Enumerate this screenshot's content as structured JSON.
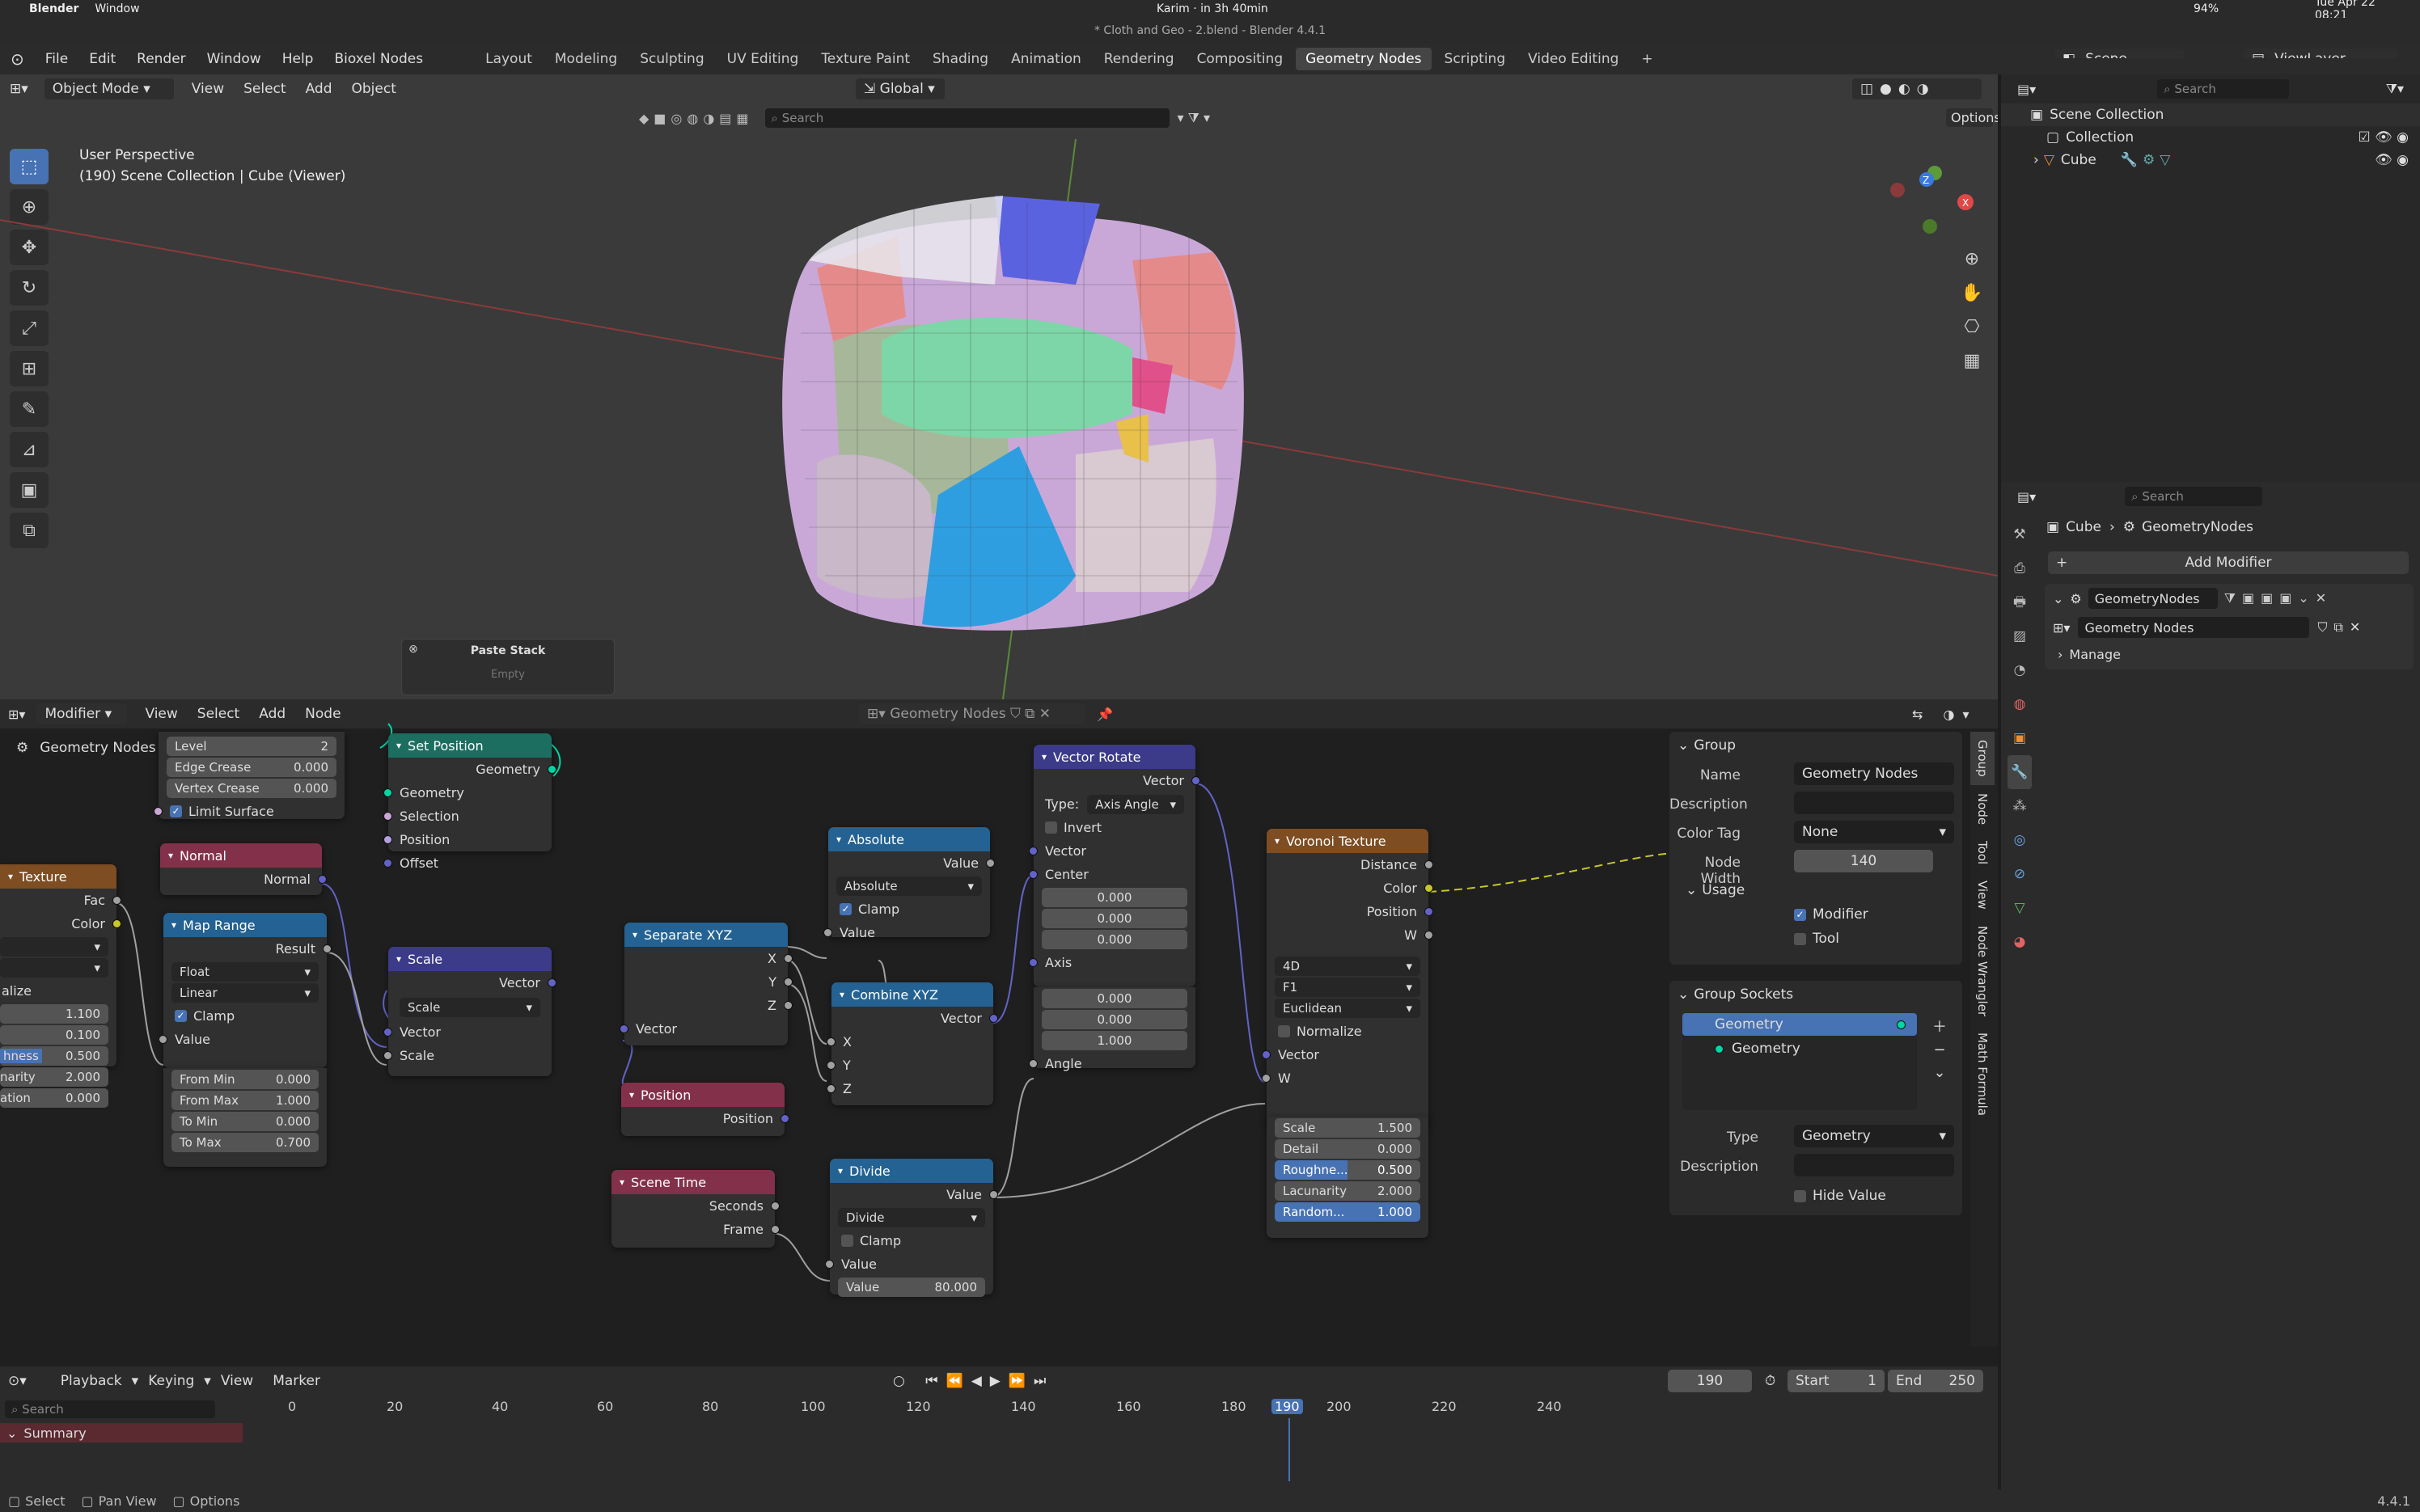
{
  "macbar": {
    "app": "Blender",
    "window": "Window",
    "center": "Karim · in 3h 40min",
    "datetime": "Tue Apr 22  08:21",
    "battery": "94%"
  },
  "titlebar": {
    "title": "* Cloth and Geo - 2.blend - Blender 4.4.1"
  },
  "topmenu": {
    "items": [
      "File",
      "Edit",
      "Render",
      "Window",
      "Help",
      "Bioxel Nodes"
    ],
    "workspaces": [
      "Layout",
      "Modeling",
      "Sculpting",
      "UV Editing",
      "Texture Paint",
      "Shading",
      "Animation",
      "Rendering",
      "Compositing",
      "Geometry Nodes",
      "Scripting",
      "Video Editing"
    ],
    "active_workspace": "Geometry Nodes",
    "scene": "Scene",
    "viewlayer": "ViewLayer"
  },
  "viewport": {
    "mode": "Object Mode",
    "menus": [
      "View",
      "Select",
      "Add",
      "Object"
    ],
    "orientation": "Global",
    "options": "Options",
    "search_placeholder": "Search",
    "perspective": "User Perspective",
    "info": "(190) Scene Collection | Cube (Viewer)",
    "paste_stack": {
      "title": "Paste Stack",
      "body": "Empty"
    }
  },
  "outliner": {
    "search_placeholder": "Search",
    "items": [
      "Scene Collection",
      "Collection",
      "Cube"
    ]
  },
  "properties": {
    "search_placeholder": "Search",
    "breadcrumb": [
      "Cube",
      "GeometryNodes"
    ],
    "add_modifier": "Add Modifier",
    "modifier_name": "GeometryNodes",
    "node_group": "Geometry Nodes",
    "manage": "Manage"
  },
  "nodeeditor": {
    "header_mode": "Modifier",
    "menus": [
      "View",
      "Select",
      "Add",
      "Node"
    ],
    "tree_name": "Geometry Nodes",
    "breadcrumb": "Geometry Nodes",
    "side_tabs": [
      "Group",
      "Node",
      "Tool",
      "View",
      "Node Wrangler",
      "Math Formula"
    ]
  },
  "nodes": {
    "subdiv": {
      "level_label": "Level",
      "level": "2",
      "edge_crease_label": "Edge Crease",
      "edge_crease": "0.000",
      "vertex_crease_label": "Vertex Crease",
      "vertex_crease": "0.000",
      "limit": "Limit Surface"
    },
    "set_position": {
      "title": "Set Position",
      "out": "Geometry",
      "inputs": [
        "Geometry",
        "Selection",
        "Position",
        "Offset"
      ]
    },
    "texture": {
      "title": "Texture",
      "outs": [
        "Fac",
        "Color"
      ],
      "partial": "alize",
      "v1": "1.100",
      "v2": "0.100",
      "r_label": "hness",
      "r": "0.500",
      "l_label": "narity",
      "l": "2.000",
      "d_label": "ation",
      "d": "0.000"
    },
    "normal": {
      "title": "Normal",
      "out": "Normal"
    },
    "map_range": {
      "title": "Map Range",
      "out": "Result",
      "type": "Float",
      "interp": "Linear",
      "clamp": "Clamp",
      "in": "Value",
      "from_min_label": "From Min",
      "from_min": "0.000",
      "from_max_label": "From Max",
      "from_max": "1.000",
      "to_min_label": "To Min",
      "to_min": "0.000",
      "to_max_label": "To Max",
      "to_max": "0.700"
    },
    "scale": {
      "title": "Scale",
      "out": "Vector",
      "op": "Scale",
      "inputs": [
        "Vector",
        "Scale"
      ]
    },
    "separate_xyz": {
      "title": "Separate XYZ",
      "outs": [
        "X",
        "Y",
        "Z"
      ],
      "in": "Vector"
    },
    "position": {
      "title": "Position",
      "out": "Position"
    },
    "scene_time": {
      "title": "Scene Time",
      "outs": [
        "Seconds",
        "Frame"
      ]
    },
    "absolute": {
      "title": "Absolute",
      "out": "Value",
      "op": "Absolute",
      "clamp": "Clamp",
      "in": "Value"
    },
    "combine_xyz": {
      "title": "Combine XYZ",
      "out": "Vector",
      "inputs": [
        "X",
        "Y",
        "Z"
      ]
    },
    "divide": {
      "title": "Divide",
      "out": "Value",
      "op": "Divide",
      "clamp": "Clamp",
      "in": "Value",
      "v_label": "Value",
      "v": "80.000"
    },
    "vector_rotate": {
      "title": "Vector Rotate",
      "out": "Vector",
      "type_label": "Type:",
      "type": "Axis Angle",
      "invert": "Invert",
      "vector": "Vector",
      "center": "Center",
      "c": [
        "0.000",
        "0.000",
        "0.000"
      ],
      "axis": "Axis",
      "a": [
        "0.000",
        "0.000",
        "1.000"
      ],
      "angle": "Angle"
    },
    "voronoi": {
      "title": "Voronoi Texture",
      "outs": [
        "Distance",
        "Color",
        "Position",
        "W"
      ],
      "dim": "4D",
      "feature": "F1",
      "metric": "Euclidean",
      "normalize": "Normalize",
      "in_vector": "Vector",
      "in_w": "W",
      "scale_label": "Scale",
      "scale": "1.500",
      "detail_label": "Detail",
      "detail": "0.000",
      "rough_label": "Roughne...",
      "rough": "0.500",
      "lac_label": "Lacunarity",
      "lac": "2.000",
      "rand_label": "Random...",
      "rand": "1.000"
    }
  },
  "group_panel": {
    "title": "Group",
    "name_label": "Name",
    "name": "Geometry Nodes",
    "desc_label": "Description",
    "color_tag_label": "Color Tag",
    "color_tag": "None",
    "node_width_label": "Node Width",
    "node_width": "140",
    "usage": "Usage",
    "modifier": "Modifier",
    "tool": "Tool",
    "sockets_title": "Group Sockets",
    "sockets": [
      "Geometry",
      "Geometry"
    ],
    "type_label": "Type",
    "type": "Geometry",
    "desc2_label": "Description",
    "hide_value": "Hide Value"
  },
  "timeline": {
    "playback": "Playback",
    "keying": "Keying",
    "view": "View",
    "marker": "Marker",
    "current": "190",
    "start_label": "Start",
    "start": "1",
    "end_label": "End",
    "end": "250",
    "search_placeholder": "Search",
    "summary": "Summary",
    "ticks": [
      "0",
      "20",
      "40",
      "60",
      "80",
      "100",
      "120",
      "140",
      "160",
      "180",
      "190",
      "200",
      "220",
      "240"
    ]
  },
  "status": {
    "select": "Select",
    "pan": "Pan View",
    "options": "Options",
    "version": "4.4.1"
  },
  "colors": {
    "accent": "#4772b3",
    "geometry_socket": "#00d6a3",
    "vector_socket": "#6363c7",
    "color_socket": "#c7c729"
  }
}
